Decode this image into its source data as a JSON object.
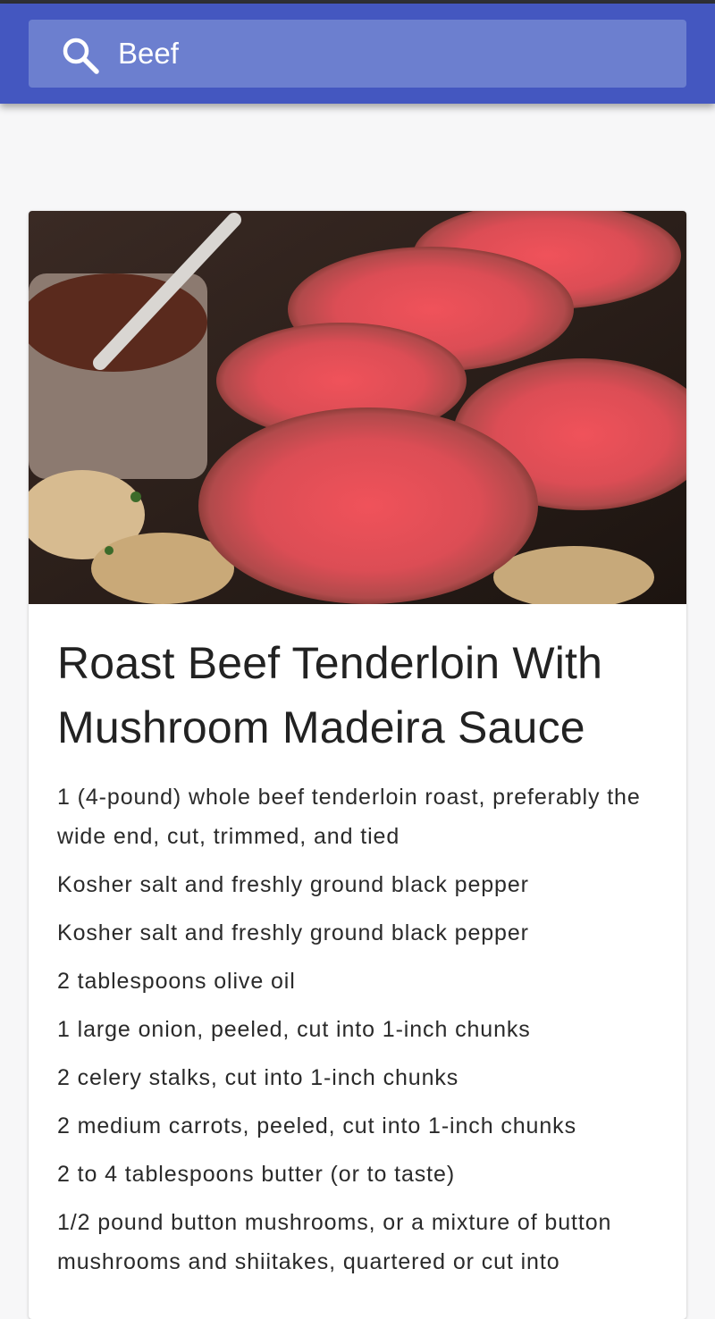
{
  "search": {
    "icon": "search-icon",
    "value": "Beef"
  },
  "recipe": {
    "image_alt": "Sliced roast beef tenderloin with mushrooms and a pot of sauce",
    "title": "Roast Beef Tenderloin With Mushroom Madeira Sauce",
    "ingredients": [
      "1 (4-pound) whole beef tenderloin roast, preferably the wide end, cut, trimmed, and tied",
      "Kosher salt and freshly ground black pepper",
      "Kosher salt and freshly ground black pepper",
      "2 tablespoons olive oil",
      "1 large onion, peeled, cut into 1-inch chunks",
      "2 celery stalks, cut into 1-inch chunks",
      "2 medium carrots, peeled, cut into 1-inch chunks",
      "2 to 4 tablespoons butter (or to taste)",
      "1/2 pound button mushrooms, or a mixture of button mushrooms and shiitakes, quartered or cut into"
    ]
  },
  "colors": {
    "appbar": "#4457c0",
    "search_field": "#6c7fcf",
    "page_background": "#f7f7f8"
  }
}
